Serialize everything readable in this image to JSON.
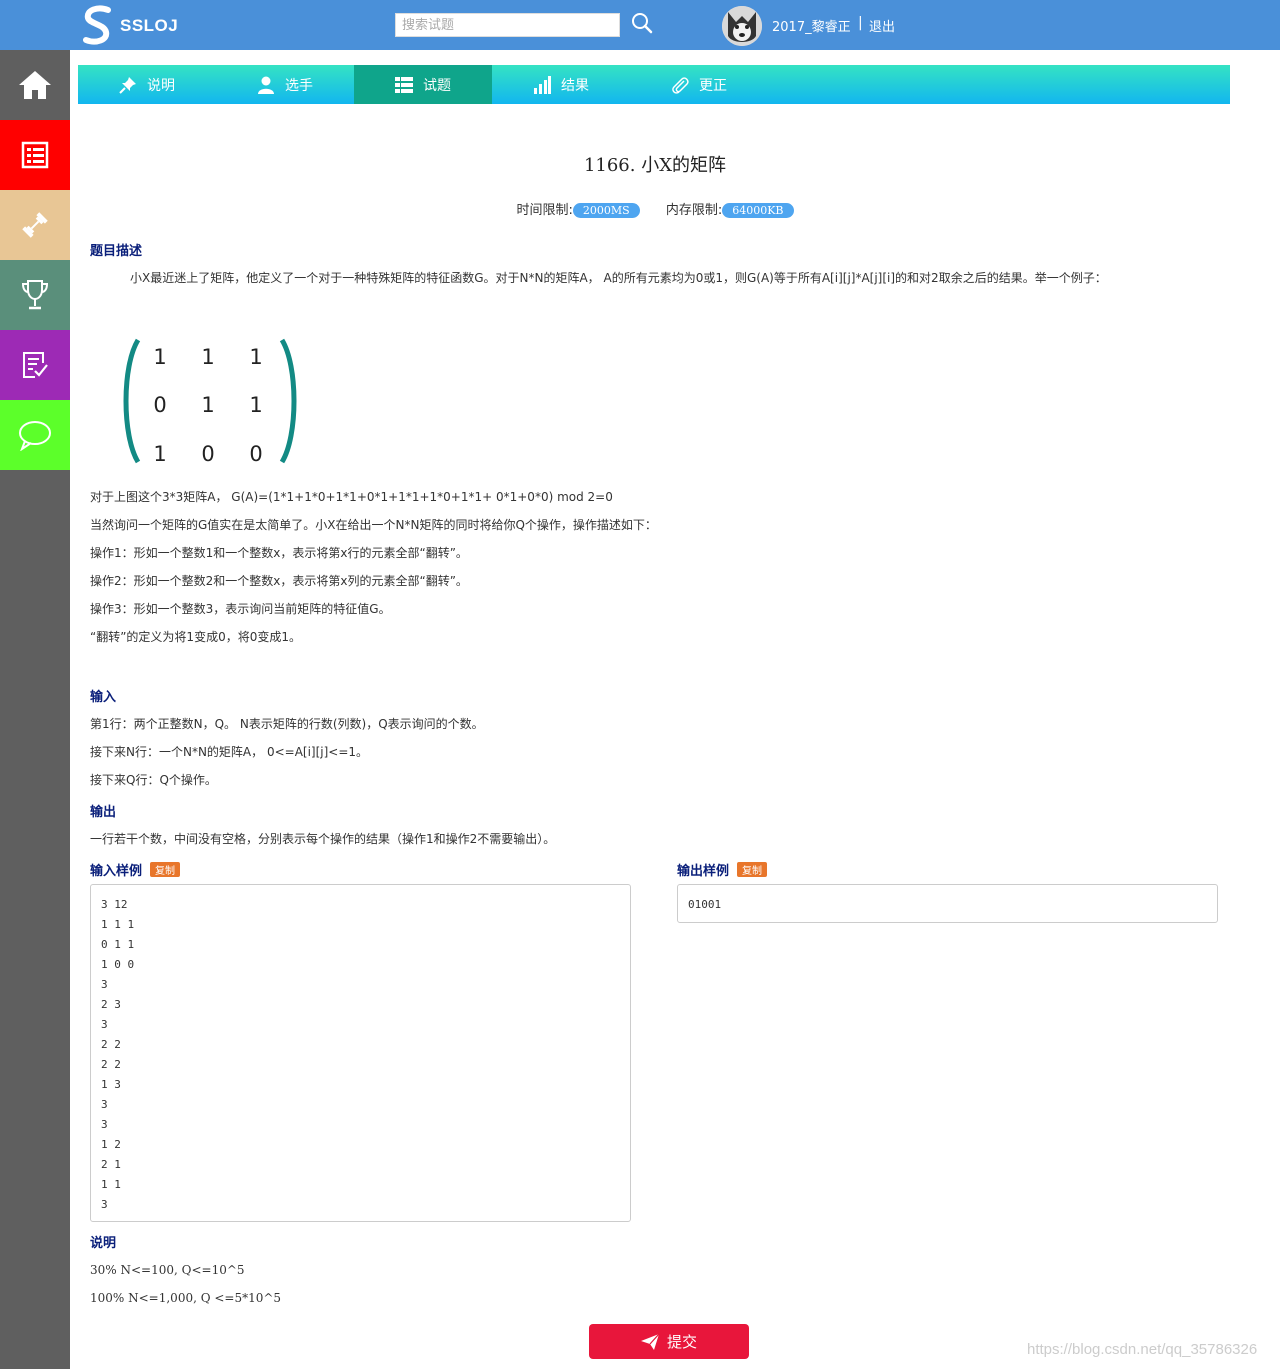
{
  "header": {
    "logo_text": "SSLOJ",
    "search_placeholder": "搜索试题",
    "username": "2017_黎睿正",
    "separator": "|",
    "logout": "退出"
  },
  "sidebar": {
    "items": [
      {
        "name": "home",
        "color": "#5f5f5f"
      },
      {
        "name": "problems",
        "color": "#ff0000"
      },
      {
        "name": "tools",
        "color": "#e8c695"
      },
      {
        "name": "contest",
        "color": "#5a8f7b"
      },
      {
        "name": "status",
        "color": "#9d2ab5"
      },
      {
        "name": "discuss",
        "color": "#5cff2a"
      }
    ]
  },
  "nav": {
    "tabs": [
      {
        "label": "说明",
        "icon": "pin-icon"
      },
      {
        "label": "选手",
        "icon": "user-icon"
      },
      {
        "label": "试题",
        "icon": "list-icon",
        "active": true
      },
      {
        "label": "结果",
        "icon": "bar-chart-icon"
      },
      {
        "label": "更正",
        "icon": "paperclip-icon"
      }
    ]
  },
  "problem": {
    "title": "1166. 小X的矩阵",
    "time_label": "时间限制:",
    "time_value": "2000MS",
    "memory_label": "内存限制:",
    "memory_value": "64000KB",
    "desc_title": "题目描述",
    "desc_p1": "小X最近迷上了矩阵，他定义了一个对于一种特殊矩阵的特征函数G。对于N*N的矩阵A， A的所有元素均为0或1，则G(A)等于所有A[i][j]*A[j][i]的和对2取余之后的结果。举一个例子：",
    "matrix": [
      [
        "1",
        "1",
        "1"
      ],
      [
        "0",
        "1",
        "1"
      ],
      [
        "1",
        "0",
        "0"
      ]
    ],
    "desc_lines": [
      "对于上图这个3*3矩阵A， G(A)=(1*1+1*0+1*1+0*1+1*1+1*0+1*1+ 0*1+0*0) mod 2=0",
      "当然询问一个矩阵的G值实在是太简单了。小X在给出一个N*N矩阵的同时将给你Q个操作，操作描述如下：",
      "操作1：形如一个整数1和一个整数x，表示将第x行的元素全部“翻转”。",
      "操作2：形如一个整数2和一个整数x，表示将第x列的元素全部“翻转”。",
      "操作3：形如一个整数3，表示询问当前矩阵的特征值G。",
      "“翻转”的定义为将1变成0，将0变成1。"
    ],
    "input_title": "输入",
    "input_lines": [
      "第1行：两个正整数N，Q。 N表示矩阵的行数(列数)，Q表示询问的个数。",
      "接下来N行：一个N*N的矩阵A， 0<=A[i][j]<=1。",
      "接下来Q行：Q个操作。"
    ],
    "output_title": "输出",
    "output_line": "一行若干个数，中间没有空格，分别表示每个操作的结果（操作1和操作2不需要输出）。",
    "sample_input_title": "输入样例",
    "sample_output_title": "输出样例",
    "copy_label": "复制",
    "sample_input": [
      "3 12",
      "1 1 1",
      "0 1 1",
      "1 0 0",
      "3",
      "2 3",
      "3",
      "2 2",
      "2 2",
      "1 3",
      "3",
      "3",
      "1 2",
      "2 1",
      "1 1",
      "3"
    ],
    "sample_output": [
      "01001"
    ],
    "note_title": "说明",
    "note_lines": [
      "30% N<=100, Q<=10^5",
      "100% N<=1,000, Q <=5*10^5"
    ],
    "submit_label": "提交"
  },
  "watermark": "https://blog.csdn.net/qq_35786326"
}
